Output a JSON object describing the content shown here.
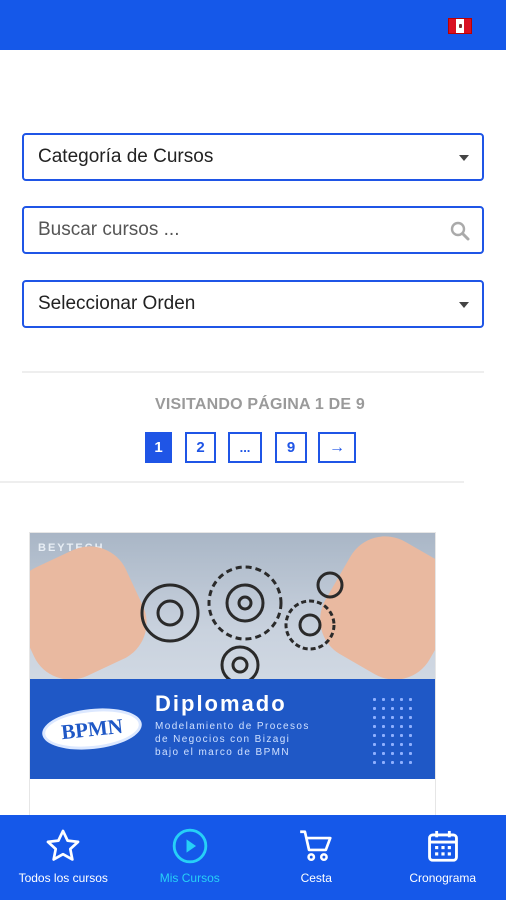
{
  "header": {
    "flag_icon": "peru-flag-icon",
    "color": "#1558e9"
  },
  "filters": {
    "category_label": "Categoría de Cursos",
    "search_placeholder": "Buscar cursos ...",
    "order_label": "Seleccionar Orden"
  },
  "pagination": {
    "status_text": "VISITANDO PÁGINA 1 DE 9",
    "pages": [
      "1",
      "2",
      "...",
      "9",
      "→"
    ],
    "current": "1"
  },
  "course_card": {
    "brand_text": "BEYTECH",
    "badge_text": "BPMN",
    "title": "Diplomado",
    "subtitle_lines": [
      "Modelamiento de Procesos",
      "de Negocios con Bizagi",
      "bajo el marco de BPMN"
    ]
  },
  "bottom_nav": {
    "items": [
      {
        "label": "Todos los cursos",
        "icon": "star-icon"
      },
      {
        "label": "Mis Cursos",
        "icon": "play-circle-icon"
      },
      {
        "label": "Cesta",
        "icon": "cart-icon"
      },
      {
        "label": "Cronograma",
        "icon": "calendar-icon"
      }
    ],
    "selected_color": "#26d0f7"
  }
}
